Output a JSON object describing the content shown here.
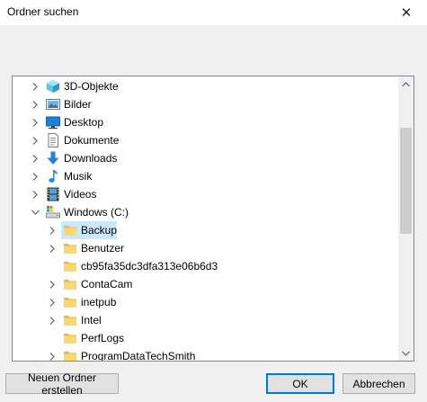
{
  "window": {
    "title": "Ordner suchen",
    "close_label": "✕"
  },
  "tree": {
    "items": [
      {
        "label": "3D-Objekte",
        "icon": "3d-objects-icon",
        "level": 0,
        "expander": "collapsed"
      },
      {
        "label": "Bilder",
        "icon": "pictures-icon",
        "level": 0,
        "expander": "collapsed"
      },
      {
        "label": "Desktop",
        "icon": "desktop-icon",
        "level": 0,
        "expander": "collapsed"
      },
      {
        "label": "Dokumente",
        "icon": "documents-icon",
        "level": 0,
        "expander": "collapsed"
      },
      {
        "label": "Downloads",
        "icon": "downloads-icon",
        "level": 0,
        "expander": "collapsed"
      },
      {
        "label": "Musik",
        "icon": "music-icon",
        "level": 0,
        "expander": "collapsed"
      },
      {
        "label": "Videos",
        "icon": "videos-icon",
        "level": 0,
        "expander": "collapsed"
      },
      {
        "label": "Windows (C:)",
        "icon": "drive-icon",
        "level": 0,
        "expander": "expanded"
      },
      {
        "label": "Backup",
        "icon": "folder-icon",
        "level": 1,
        "expander": "collapsed",
        "selected": true
      },
      {
        "label": "Benutzer",
        "icon": "folder-icon",
        "level": 1,
        "expander": "collapsed"
      },
      {
        "label": "cb95fa35dc3dfa313e06b6d3",
        "icon": "folder-icon",
        "level": 1,
        "expander": "none"
      },
      {
        "label": "ContaCam",
        "icon": "folder-icon",
        "level": 1,
        "expander": "collapsed"
      },
      {
        "label": "inetpub",
        "icon": "folder-icon",
        "level": 1,
        "expander": "collapsed"
      },
      {
        "label": "Intel",
        "icon": "folder-icon",
        "level": 1,
        "expander": "collapsed"
      },
      {
        "label": "PerfLogs",
        "icon": "folder-icon",
        "level": 1,
        "expander": "none"
      },
      {
        "label": "ProgramDataTechSmith",
        "icon": "folder-icon",
        "level": 1,
        "expander": "collapsed"
      }
    ]
  },
  "buttons": {
    "new_folder": "Neuen Ordner erstellen",
    "ok": "OK",
    "cancel": "Abbrechen"
  },
  "colors": {
    "selection": "#cce8ff",
    "folder": "#f8d775",
    "accent": "#0078d7"
  }
}
